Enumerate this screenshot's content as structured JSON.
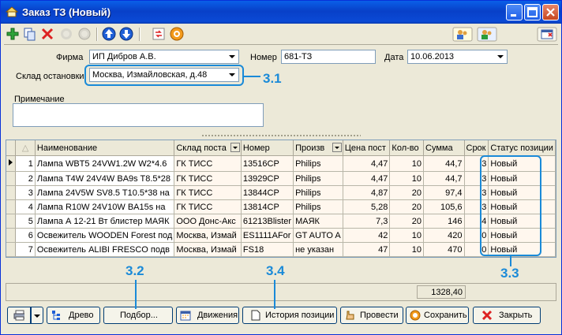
{
  "window": {
    "title": "Заказ ТЗ (Новый)"
  },
  "toolbar": {
    "icons": [
      "add-icon",
      "copy-icon",
      "delete-icon",
      "disabled-icon",
      "disabled-icon",
      "up-icon",
      "down-icon",
      "arrows-icon",
      "target-icon",
      "users-icon",
      "users-icon",
      "window-close-icon"
    ]
  },
  "form": {
    "firm_label": "Фирма",
    "firm_value": "ИП Дибров А.В.",
    "number_label": "Номер",
    "number_value": "681-ТЗ",
    "date_label": "Дата",
    "date_value": "10.06.2013",
    "warehouse_label": "Склад остановки",
    "warehouse_value": "Москва, Измайловская, д.48",
    "note_label": "Примечание",
    "note_value": ""
  },
  "grid": {
    "columns": [
      "Наименование",
      "Склад поста",
      "Номер",
      "Произв",
      "Цена пост",
      "Кол-во",
      "Сумма",
      "Срок",
      "Статус позиции"
    ],
    "rows": [
      {
        "n": "1",
        "name": "Лампа WBT5 24VW1.2W W2*4.6",
        "wh": "ГК ТИСС",
        "num": "13516CP",
        "mfr": "Philips",
        "price": "4,47",
        "qty": "10",
        "sum": "44,7",
        "term": "3",
        "status": "Новый"
      },
      {
        "n": "2",
        "name": "Лампа T4W 24V4W BA9s T8.5*28",
        "wh": "ГК ТИСС",
        "num": "13929CP",
        "mfr": "Philips",
        "price": "4,47",
        "qty": "10",
        "sum": "44,7",
        "term": "3",
        "status": "Новый"
      },
      {
        "n": "3",
        "name": "Лампа 24V5W SV8.5 T10.5*38 на",
        "wh": "ГК ТИСС",
        "num": "13844CP",
        "mfr": "Philips",
        "price": "4,87",
        "qty": "20",
        "sum": "97,4",
        "term": "3",
        "status": "Новый"
      },
      {
        "n": "4",
        "name": "Лампа R10W 24V10W BA15s на",
        "wh": "ГК ТИСС",
        "num": "13814CP",
        "mfr": "Philips",
        "price": "5,28",
        "qty": "20",
        "sum": "105,6",
        "term": "3",
        "status": "Новый"
      },
      {
        "n": "5",
        "name": "Лампа А 12-21 Вт блистер МАЯК",
        "wh": "ООО Донс-Акс",
        "num": "61213Blister",
        "mfr": "МАЯК",
        "price": "7,3",
        "qty": "20",
        "sum": "146",
        "term": "4",
        "status": "Новый"
      },
      {
        "n": "6",
        "name": "Освежитель WOODEN Forest под",
        "wh": "Москва, Измай",
        "num": "ES1111AFor",
        "mfr": "GT AUTO A",
        "price": "42",
        "qty": "10",
        "sum": "420",
        "term": "0",
        "status": "Новый"
      },
      {
        "n": "7",
        "name": "Освежитель ALIBI FRESCO подв",
        "wh": "Москва, Измай",
        "num": "FS18",
        "mfr": "не указан",
        "price": "47",
        "qty": "10",
        "sum": "470",
        "term": "0",
        "status": "Новый"
      }
    ],
    "total": "1328,40"
  },
  "buttons": {
    "tree": "Древо",
    "select": "Подбор...",
    "movements": "Движения",
    "history": "История позиции",
    "post": "Провести",
    "save": "Сохранить",
    "close": "Закрыть"
  },
  "callouts": {
    "c31": "3.1",
    "c32": "3.2",
    "c33": "3.3",
    "c34": "3.4"
  },
  "colors": {
    "accent": "#1a8ad8",
    "titlebar": "#0a4ad6"
  }
}
